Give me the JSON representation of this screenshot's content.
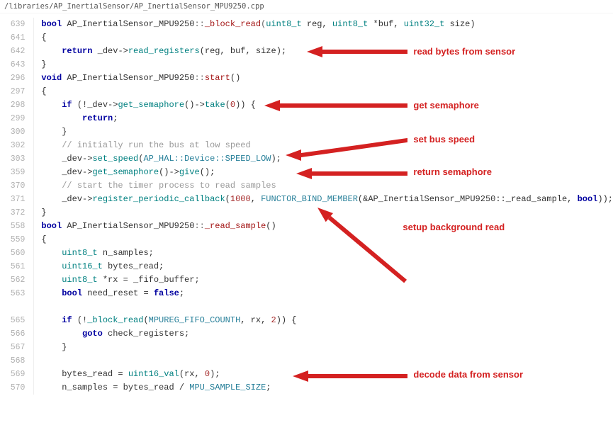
{
  "file_path": "/libraries/AP_InertialSensor/AP_InertialSensor_MPU9250.cpp",
  "lines": [
    {
      "num": "639"
    },
    {
      "num": "641"
    },
    {
      "num": "642"
    },
    {
      "num": "643"
    },
    {
      "num": "296"
    },
    {
      "num": "297"
    },
    {
      "num": "298"
    },
    {
      "num": "299"
    },
    {
      "num": "300"
    },
    {
      "num": "302"
    },
    {
      "num": "303"
    },
    {
      "num": "359"
    },
    {
      "num": "370"
    },
    {
      "num": "371"
    },
    {
      "num": "372"
    },
    {
      "num": "558"
    },
    {
      "num": "559"
    },
    {
      "num": "560"
    },
    {
      "num": "561"
    },
    {
      "num": "562"
    },
    {
      "num": "563"
    },
    {
      "num": ""
    },
    {
      "num": "565"
    },
    {
      "num": "566"
    },
    {
      "num": "567"
    },
    {
      "num": "568"
    },
    {
      "num": "569"
    },
    {
      "num": "570"
    }
  ],
  "code": {
    "l639_bool": "bool",
    "l639_class": "AP_InertialSensor_MPU9250",
    "l639_scope": "::",
    "l639_fn": "_block_read",
    "l639_lp": "(",
    "l639_p1t": "uint8_t",
    "l639_p1": " reg, ",
    "l639_p2t": "uint8_t",
    "l639_p2": " *buf, ",
    "l639_p3t": "uint32_t",
    "l639_p3": " size)",
    "l641_brace": "{",
    "l642_return": "return",
    "l642_sp": " _dev->",
    "l642_call": "read_registers",
    "l642_args": "(reg, buf, size);",
    "l643_brace": "}",
    "l296_void": "void",
    "l296_class": "AP_InertialSensor_MPU9250",
    "l296_scope": "::",
    "l296_fn": "start",
    "l296_paren": "()",
    "l297_brace": "{",
    "l298_if": "if",
    "l298_lp": " (!_dev->",
    "l298_call1": "get_semaphore",
    "l298_mid": "()->",
    "l298_call2": "take",
    "l298_arg": "(",
    "l298_zero": "0",
    "l298_end": ")) {",
    "l299_return": "return",
    "l299_sc": ";",
    "l300_brace": "}",
    "l302_comment": "// initially run the bus at low speed",
    "l303_pre": "_dev->",
    "l303_call": "set_speed",
    "l303_lp": "(",
    "l303_arg": "AP_HAL::Device::SPEED_LOW",
    "l303_rp": ");",
    "l359_pre": "_dev->",
    "l359_call1": "get_semaphore",
    "l359_mid": "()->",
    "l359_call2": "give",
    "l359_end": "();",
    "l370_comment": "// start the timer process to read samples",
    "l371_pre": "_dev->",
    "l371_call": "register_periodic_callback",
    "l371_lp": "(",
    "l371_num": "1000",
    "l371_comma": ", ",
    "l371_functor": "FUNCTOR_BIND_MEMBER",
    "l371_args": "(&AP_InertialSensor_MPU9250::_read_sample, ",
    "l371_bool": "bool",
    "l371_rp": "));",
    "l372_brace": "}",
    "l558_bool": "bool",
    "l558_class": "AP_InertialSensor_MPU9250",
    "l558_scope": "::",
    "l558_fn": "_read_sample",
    "l558_paren": "()",
    "l559_brace": "{",
    "l560_t": "uint8_t",
    "l560_v": " n_samples;",
    "l561_t": "uint16_t",
    "l561_v": " bytes_read;",
    "l562_t": "uint8_t",
    "l562_v": " *rx = _fifo_buffer;",
    "l563_t": "bool",
    "l563_v": " need_reset = ",
    "l563_false": "false",
    "l563_sc": ";",
    "l565_if": "if",
    "l565_lp": " (!",
    "l565_call": "_block_read",
    "l565_arga": "(",
    "l565_const": "MPUREG_FIFO_COUNTH",
    "l565_argb": ", rx, ",
    "l565_two": "2",
    "l565_end": ")) {",
    "l566_goto": "goto",
    "l566_lbl": " check_registers;",
    "l567_brace": "}",
    "l569_pre": "bytes_read = ",
    "l569_call": "uint16_val",
    "l569_lp": "(rx, ",
    "l569_zero": "0",
    "l569_rp": ");",
    "l570_pre": "n_samples = bytes_read / ",
    "l570_const": "MPU_SAMPLE_SIZE",
    "l570_sc": ";"
  },
  "annotations": {
    "a1": "read bytes from sensor",
    "a2": "get semaphore",
    "a3": "set bus speed",
    "a4": "return semaphore",
    "a5": "setup background read",
    "a6": "decode data from sensor"
  }
}
